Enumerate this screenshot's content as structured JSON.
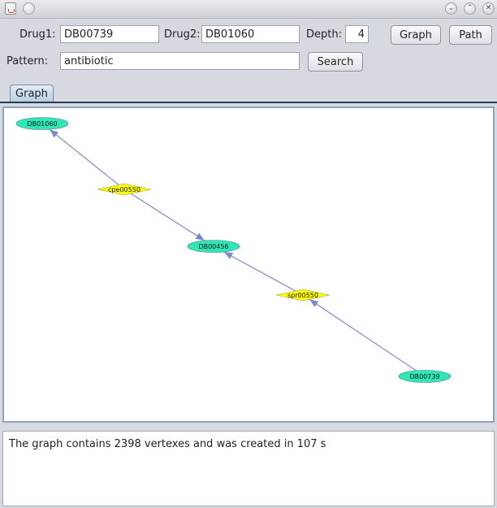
{
  "titlebar": {
    "buttons": [
      "⌄",
      "⌃",
      "✕"
    ]
  },
  "form": {
    "drug1_label": "Drug1:",
    "drug1_value": "DB00739",
    "drug2_label": "Drug2:",
    "drug2_value": "DB01060",
    "depth_label": "Depth:",
    "depth_value": "4",
    "pattern_label": "Pattern:",
    "pattern_value": "antibiotic",
    "graph_button": "Graph",
    "path_button": "Path",
    "search_button": "Search"
  },
  "tabs": [
    {
      "label": "Graph"
    }
  ],
  "graph": {
    "nodes": [
      {
        "id": "DB01060",
        "shape": "ellipse"
      },
      {
        "id": "cpe00550",
        "shape": "diamond"
      },
      {
        "id": "DB00456",
        "shape": "ellipse"
      },
      {
        "id": "spr00550",
        "shape": "diamond"
      },
      {
        "id": "DB00739",
        "shape": "ellipse"
      }
    ],
    "edges": [
      {
        "from": "cpe00550",
        "to": "DB01060"
      },
      {
        "from": "cpe00550",
        "to": "DB00456"
      },
      {
        "from": "spr00550",
        "to": "DB00456"
      },
      {
        "from": "DB00739",
        "to": "spr00550"
      }
    ],
    "colors": {
      "ellipse": "#2de8b5",
      "diamond": "#ffff00",
      "edge": "#7f8ac9"
    }
  },
  "status": {
    "text": "The graph contains 2398 vertexes and was created in 107 s"
  }
}
